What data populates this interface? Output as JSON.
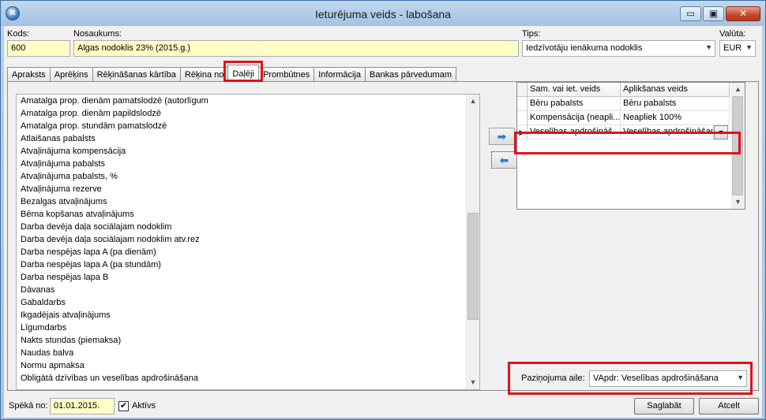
{
  "window": {
    "title": "Ieturējuma veids - labošana",
    "minimize_glyph": "▭",
    "restore_glyph": "▣",
    "close_glyph": "✕"
  },
  "header": {
    "kods_label": "Kods:",
    "kods_value": "600",
    "nosaukums_label": "Nosaukums:",
    "nosaukums_value": "Algas nodoklis 23% (2015.g.)",
    "tips_label": "Tips:",
    "tips_value": "Iedzīvotāju ienākuma nodoklis",
    "valuta_label": "Valūta:",
    "valuta_value": "EUR"
  },
  "tabs": [
    "Apraksts",
    "Aprēķins",
    "Rēķināšanas kārtība",
    "Rēķina no",
    "Daļēji",
    "Prombūtnes",
    "Informācija",
    "Bankas pārvedumam"
  ],
  "available_list": [
    "Amatalga prop. dienām pamatslodzē (autorlīgum",
    "Amatalga prop. dienām papildslodzē",
    "Amatalga prop. stundām pamatslodzē",
    "Atlaišanas pabalsts",
    "Atvaļinājuma kompensācija",
    "Atvaļinājuma pabalsts",
    "Atvaļinājuma pabalsts, %",
    "Atvaļinājuma rezerve",
    "Bezalgas atvaļinājums",
    "Bērna kopšanas atvaļinājums",
    "Darba devēja daļa sociālajam nodoklim",
    "Darba devēja daļa sociālajam nodoklim atv.rez",
    "Darba nespējas lapa  A (pa dienām)",
    "Darba nespējas lapa  A (pa stundām)",
    "Darba nespējas lapa  B",
    "Dāvanas",
    "Gabaldarbs",
    "Ikgadējais atvaļinājums",
    "Līgumdarbs",
    "Nakts stundas (piemaksa)",
    "Naudas balva",
    "Normu apmaksa",
    "Obligātā dzīvības un veselības apdrošināšana"
  ],
  "buttons": {
    "move_right_glyph": "➡",
    "move_left_glyph": "⬅",
    "save": "Saglabāt",
    "cancel": "Atcelt"
  },
  "selected_grid": {
    "headers": [
      "Sam. vai iet. veids",
      "Aplikšanas veids"
    ],
    "rows": [
      {
        "indicator": "",
        "col1": "Bēru pabalsts",
        "col2": "Bēru pabalsts"
      },
      {
        "indicator": "",
        "col1": "Kompensācija (neapli...",
        "col2": "Neapliek 100%"
      },
      {
        "indicator": "▶",
        "col1": "Veselības apdrošināš...",
        "col2": "Veselības apdrošināšana"
      }
    ]
  },
  "pazinojuma_aile": {
    "label": "Paziņojuma aile:",
    "value": "VApdr: Veselības apdrošināšana"
  },
  "footer": {
    "speka_label": "Spēkā no:",
    "speka_value": "01.01.2015.",
    "aktivs_label": "Aktīvs",
    "aktivs_checked": "✔"
  }
}
